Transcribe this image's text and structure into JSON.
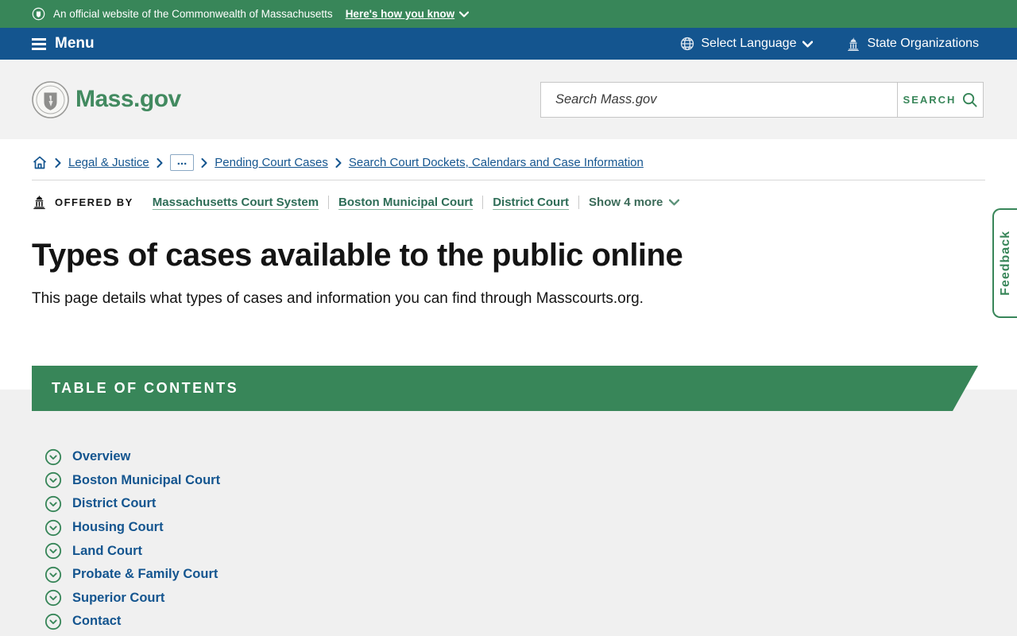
{
  "banner": {
    "official_text": "An official website of the Commonwealth of Massachusetts",
    "how_you_know": "Here's how you know"
  },
  "nav": {
    "menu_label": "Menu",
    "select_language": "Select Language",
    "state_organizations": "State Organizations"
  },
  "header": {
    "site_name": "Mass.gov",
    "search_placeholder": "Search Mass.gov",
    "search_button": "SEARCH"
  },
  "breadcrumb": {
    "items": [
      "Legal & Justice",
      "...",
      "Pending Court Cases",
      "Search Court Dockets, Calendars and Case Information"
    ]
  },
  "offered_by": {
    "label": "OFFERED BY",
    "links": [
      "Massachusetts Court System",
      "Boston Municipal Court",
      "District Court"
    ],
    "show_more": "Show 4 more"
  },
  "page": {
    "title": "Types of cases available to the public online",
    "description": "This page details what types of cases and information you can find through Masscourts.org."
  },
  "toc": {
    "heading": "TABLE OF CONTENTS",
    "items": [
      "Overview",
      "Boston Municipal Court",
      "District Court",
      "Housing Court",
      "Land Court",
      "Probate & Family Court",
      "Superior Court",
      "Contact"
    ]
  },
  "feedback": {
    "label": "Feedback"
  },
  "colors": {
    "green": "#388659",
    "blue": "#14558F",
    "offered_link_green": "#2e6d57",
    "header_gray": "#f2f2f2",
    "section_gray": "#f0f0f0"
  }
}
